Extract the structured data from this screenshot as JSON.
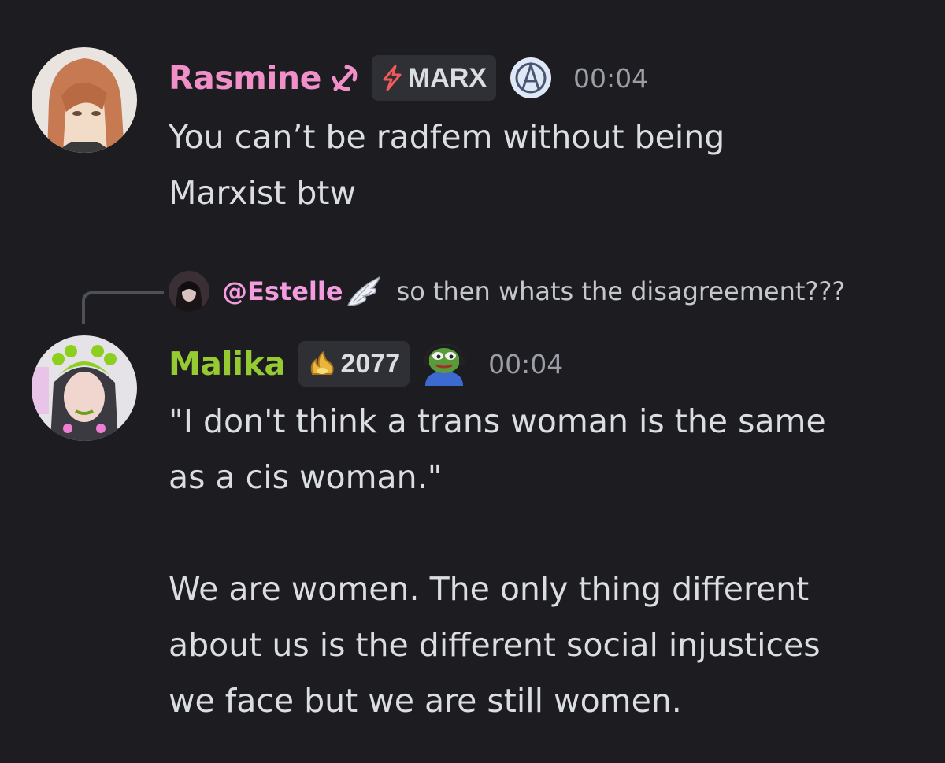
{
  "colors": {
    "background": "#1c1c21",
    "rasmine_name": "#f08fc8",
    "malika_name": "#96ca33",
    "estelle_name": "#f39de0",
    "timestamp": "#9b9ea6",
    "text": "#dbdee1"
  },
  "messages": [
    {
      "username": "Rasmine",
      "name_icon": "hammer-sickle-icon",
      "badge_label": "MARX",
      "badge_icon": "lightning-icon",
      "extra_icon": "anarchy-a-icon",
      "timestamp": "00:04",
      "lines": [
        "You can’t be radfem without being",
        "Marxist btw"
      ]
    },
    {
      "reply": {
        "mention": "@Estelle",
        "mention_icon": "wing-icon",
        "preview": "so then whats the disagreement???"
      },
      "username": "Malika",
      "badge_label": "2077",
      "badge_icon": "flame-icon",
      "extra_icon": "pepe-headset-icon",
      "timestamp": "00:04",
      "lines": [
        "\"I don't think a trans woman is the same",
        "as a cis woman.\"",
        "",
        "We are women. The only thing different",
        "about us is the different social injustices",
        "we face but we are still women."
      ]
    }
  ]
}
